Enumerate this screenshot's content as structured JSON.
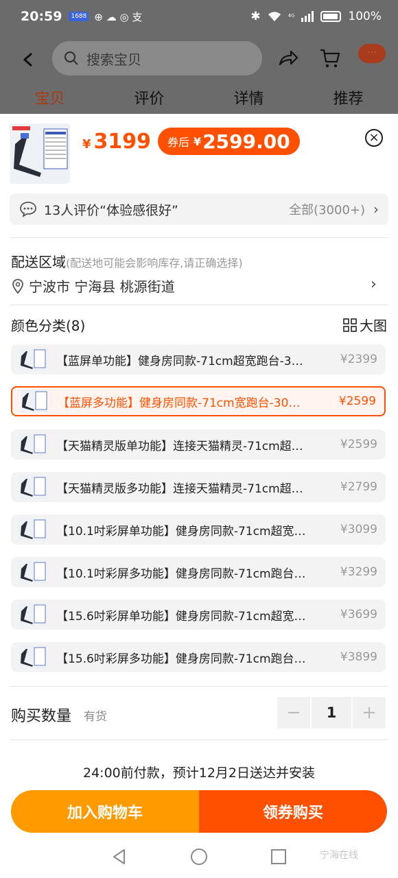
{
  "status_bar": {
    "time": "20:59",
    "notif_pill": "1688",
    "notif_glyphs": "⊕ ☁ ◎ 支",
    "network": "⁴ᴳ",
    "battery": "100%"
  },
  "header": {
    "search_placeholder": "搜索宝贝",
    "more_label": "···",
    "tabs": [
      {
        "label": "宝贝",
        "active": true
      },
      {
        "label": "评价",
        "active": false
      },
      {
        "label": "详情",
        "active": false
      },
      {
        "label": "推荐",
        "active": false
      }
    ]
  },
  "sku_sheet": {
    "price_symbol": "¥",
    "price": "3199",
    "coupon_label": "券后",
    "coupon_symbol": "¥",
    "coupon_price": "2599.00",
    "review_summary": "13人评价“体验感很好”",
    "review_all": "全部(3000+)",
    "delivery_title": "配送区域",
    "delivery_note": "(配送地可能会影响库存,请正确选择)",
    "delivery_address": "宁波市 宁海县 桃源街道",
    "color_title": "颜色分类(8)",
    "big_picture": "大图",
    "options": [
      {
        "name": "【蓝屏单功能】健身房同款-71cm超宽跑台-3…",
        "price": "¥2399",
        "selected": false
      },
      {
        "name": "【蓝屏多功能】健身房同款-71cm宽跑台-30…",
        "price": "¥2599",
        "selected": true
      },
      {
        "name": "【天猫精灵版单功能】连接天猫精灵-71cm超…",
        "price": "¥2599",
        "selected": false
      },
      {
        "name": "【天猫精灵版多功能】连接天猫精灵-71cm超…",
        "price": "¥2799",
        "selected": false
      },
      {
        "name": "【10.1吋彩屏单功能】健身房同款-71cm超宽…",
        "price": "¥3099",
        "selected": false
      },
      {
        "name": "【10.1吋彩屏多功能】健身房同款-71cm跑台…",
        "price": "¥3299",
        "selected": false
      },
      {
        "name": "【15.6吋彩屏单功能】健身房同款-71cm超宽…",
        "price": "¥3699",
        "selected": false
      },
      {
        "name": "【15.6吋彩屏多功能】健身房同款-71cm跑台…",
        "price": "¥3899",
        "selected": false
      }
    ],
    "quantity_label": "购买数量",
    "stock_status": "有货",
    "quantity": "1",
    "minus": "−",
    "plus": "+",
    "delivery_promise": "24:00前付款，预计12月2日送达并安装",
    "add_to_cart": "加入购物车",
    "buy_with_coupon": "领券购买"
  },
  "watermark": "宁海在线",
  "colors": {
    "accent": "#ff5000",
    "cart": "#ff9a00",
    "overlay": "#6b6b6b"
  }
}
